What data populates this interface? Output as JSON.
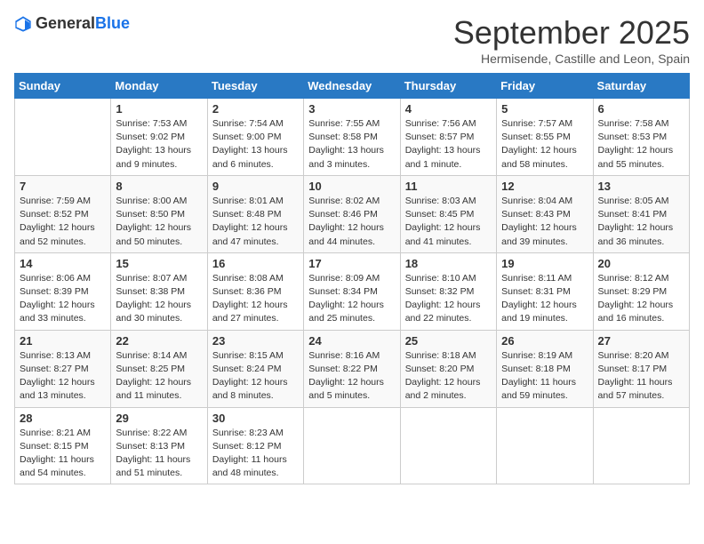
{
  "logo": {
    "general": "General",
    "blue": "Blue"
  },
  "title": "September 2025",
  "subtitle": "Hermisende, Castille and Leon, Spain",
  "days_of_week": [
    "Sunday",
    "Monday",
    "Tuesday",
    "Wednesday",
    "Thursday",
    "Friday",
    "Saturday"
  ],
  "weeks": [
    [
      {
        "day": "",
        "info": ""
      },
      {
        "day": "1",
        "info": "Sunrise: 7:53 AM\nSunset: 9:02 PM\nDaylight: 13 hours\nand 9 minutes."
      },
      {
        "day": "2",
        "info": "Sunrise: 7:54 AM\nSunset: 9:00 PM\nDaylight: 13 hours\nand 6 minutes."
      },
      {
        "day": "3",
        "info": "Sunrise: 7:55 AM\nSunset: 8:58 PM\nDaylight: 13 hours\nand 3 minutes."
      },
      {
        "day": "4",
        "info": "Sunrise: 7:56 AM\nSunset: 8:57 PM\nDaylight: 13 hours\nand 1 minute."
      },
      {
        "day": "5",
        "info": "Sunrise: 7:57 AM\nSunset: 8:55 PM\nDaylight: 12 hours\nand 58 minutes."
      },
      {
        "day": "6",
        "info": "Sunrise: 7:58 AM\nSunset: 8:53 PM\nDaylight: 12 hours\nand 55 minutes."
      }
    ],
    [
      {
        "day": "7",
        "info": "Sunrise: 7:59 AM\nSunset: 8:52 PM\nDaylight: 12 hours\nand 52 minutes."
      },
      {
        "day": "8",
        "info": "Sunrise: 8:00 AM\nSunset: 8:50 PM\nDaylight: 12 hours\nand 50 minutes."
      },
      {
        "day": "9",
        "info": "Sunrise: 8:01 AM\nSunset: 8:48 PM\nDaylight: 12 hours\nand 47 minutes."
      },
      {
        "day": "10",
        "info": "Sunrise: 8:02 AM\nSunset: 8:46 PM\nDaylight: 12 hours\nand 44 minutes."
      },
      {
        "day": "11",
        "info": "Sunrise: 8:03 AM\nSunset: 8:45 PM\nDaylight: 12 hours\nand 41 minutes."
      },
      {
        "day": "12",
        "info": "Sunrise: 8:04 AM\nSunset: 8:43 PM\nDaylight: 12 hours\nand 39 minutes."
      },
      {
        "day": "13",
        "info": "Sunrise: 8:05 AM\nSunset: 8:41 PM\nDaylight: 12 hours\nand 36 minutes."
      }
    ],
    [
      {
        "day": "14",
        "info": "Sunrise: 8:06 AM\nSunset: 8:39 PM\nDaylight: 12 hours\nand 33 minutes."
      },
      {
        "day": "15",
        "info": "Sunrise: 8:07 AM\nSunset: 8:38 PM\nDaylight: 12 hours\nand 30 minutes."
      },
      {
        "day": "16",
        "info": "Sunrise: 8:08 AM\nSunset: 8:36 PM\nDaylight: 12 hours\nand 27 minutes."
      },
      {
        "day": "17",
        "info": "Sunrise: 8:09 AM\nSunset: 8:34 PM\nDaylight: 12 hours\nand 25 minutes."
      },
      {
        "day": "18",
        "info": "Sunrise: 8:10 AM\nSunset: 8:32 PM\nDaylight: 12 hours\nand 22 minutes."
      },
      {
        "day": "19",
        "info": "Sunrise: 8:11 AM\nSunset: 8:31 PM\nDaylight: 12 hours\nand 19 minutes."
      },
      {
        "day": "20",
        "info": "Sunrise: 8:12 AM\nSunset: 8:29 PM\nDaylight: 12 hours\nand 16 minutes."
      }
    ],
    [
      {
        "day": "21",
        "info": "Sunrise: 8:13 AM\nSunset: 8:27 PM\nDaylight: 12 hours\nand 13 minutes."
      },
      {
        "day": "22",
        "info": "Sunrise: 8:14 AM\nSunset: 8:25 PM\nDaylight: 12 hours\nand 11 minutes."
      },
      {
        "day": "23",
        "info": "Sunrise: 8:15 AM\nSunset: 8:24 PM\nDaylight: 12 hours\nand 8 minutes."
      },
      {
        "day": "24",
        "info": "Sunrise: 8:16 AM\nSunset: 8:22 PM\nDaylight: 12 hours\nand 5 minutes."
      },
      {
        "day": "25",
        "info": "Sunrise: 8:18 AM\nSunset: 8:20 PM\nDaylight: 12 hours\nand 2 minutes."
      },
      {
        "day": "26",
        "info": "Sunrise: 8:19 AM\nSunset: 8:18 PM\nDaylight: 11 hours\nand 59 minutes."
      },
      {
        "day": "27",
        "info": "Sunrise: 8:20 AM\nSunset: 8:17 PM\nDaylight: 11 hours\nand 57 minutes."
      }
    ],
    [
      {
        "day": "28",
        "info": "Sunrise: 8:21 AM\nSunset: 8:15 PM\nDaylight: 11 hours\nand 54 minutes."
      },
      {
        "day": "29",
        "info": "Sunrise: 8:22 AM\nSunset: 8:13 PM\nDaylight: 11 hours\nand 51 minutes."
      },
      {
        "day": "30",
        "info": "Sunrise: 8:23 AM\nSunset: 8:12 PM\nDaylight: 11 hours\nand 48 minutes."
      },
      {
        "day": "",
        "info": ""
      },
      {
        "day": "",
        "info": ""
      },
      {
        "day": "",
        "info": ""
      },
      {
        "day": "",
        "info": ""
      }
    ]
  ]
}
